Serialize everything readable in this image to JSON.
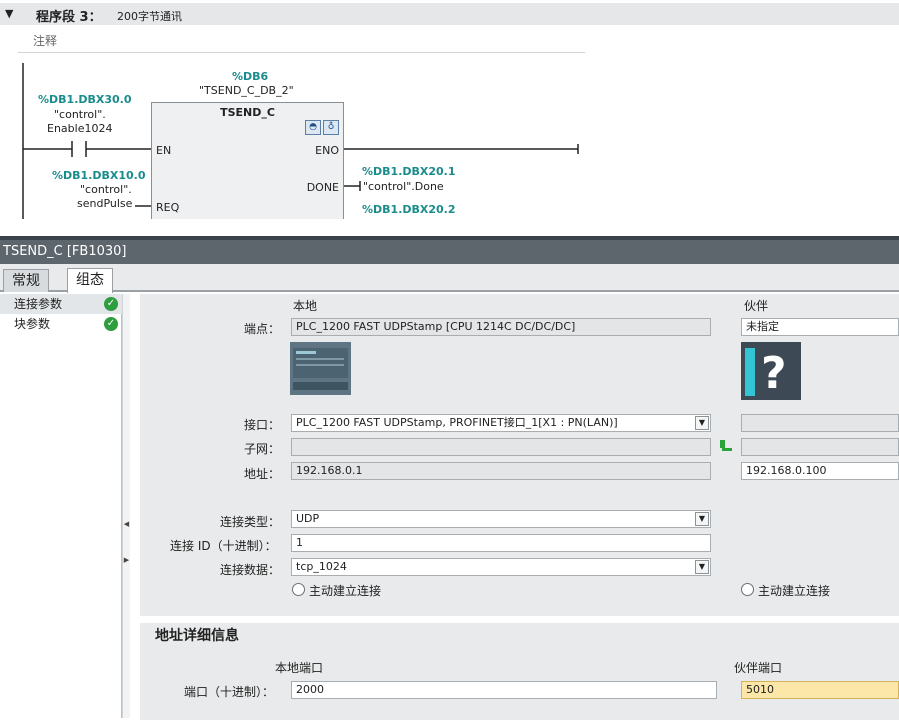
{
  "ladder": {
    "network_label": "程序段 3：",
    "network_title": "200字节通讯",
    "comment_placeholder": "注释",
    "db_instance_addr": "%DB6",
    "db_instance_name": "\"TSEND_C_DB_2\"",
    "fb_name": "TSEND_C",
    "contact_addr": "%DB1.DBX30.0",
    "contact_sym1": "\"control\".",
    "contact_sym2": "Enable1024",
    "req_addr": "%DB1.DBX10.0",
    "req_sym1": "\"control\".",
    "req_sym2": "sendPulse",
    "pin_en": "EN",
    "pin_eno": "ENO",
    "pin_done": "DONE",
    "pin_req": "REQ",
    "done_addr": "%DB1.DBX20.1",
    "done_sym": "\"control\".Done",
    "busy_addr": "%DB1.DBX20.2"
  },
  "inspector": {
    "title": "TSEND_C [FB1030]",
    "tabs": [
      "常规",
      "组态"
    ],
    "nav": [
      {
        "label": "连接参数"
      },
      {
        "label": "块参数"
      }
    ],
    "col_local": "本地",
    "col_partner": "伙伴",
    "endpoint_label": "端点：",
    "endpoint_local": "PLC_1200 FAST UDPStamp [CPU 1214C DC/DC/DC]",
    "endpoint_partner": "未指定",
    "interface_label": "接口：",
    "interface_local": "PLC_1200 FAST UDPStamp, PROFINET接口_1[X1 : PN(LAN)]",
    "subnet_label": "子网：",
    "address_label": "地址：",
    "address_local": "192.168.0.1",
    "address_partner": "192.168.0.100",
    "conn_type_label": "连接类型：",
    "conn_type": "UDP",
    "conn_id_label": "连接 ID（十进制）：",
    "conn_id": "1",
    "conn_data_label": "连接数据：",
    "conn_data": "tcp_1024",
    "active_conn_local": "主动建立连接",
    "active_conn_partner": "主动建立连接",
    "details_title": "地址详细信息",
    "local_port_label": "本地端口",
    "partner_port_label": "伙伴端口",
    "port_label": "端口（十进制）：",
    "local_port": "2000",
    "partner_port": "5010"
  }
}
